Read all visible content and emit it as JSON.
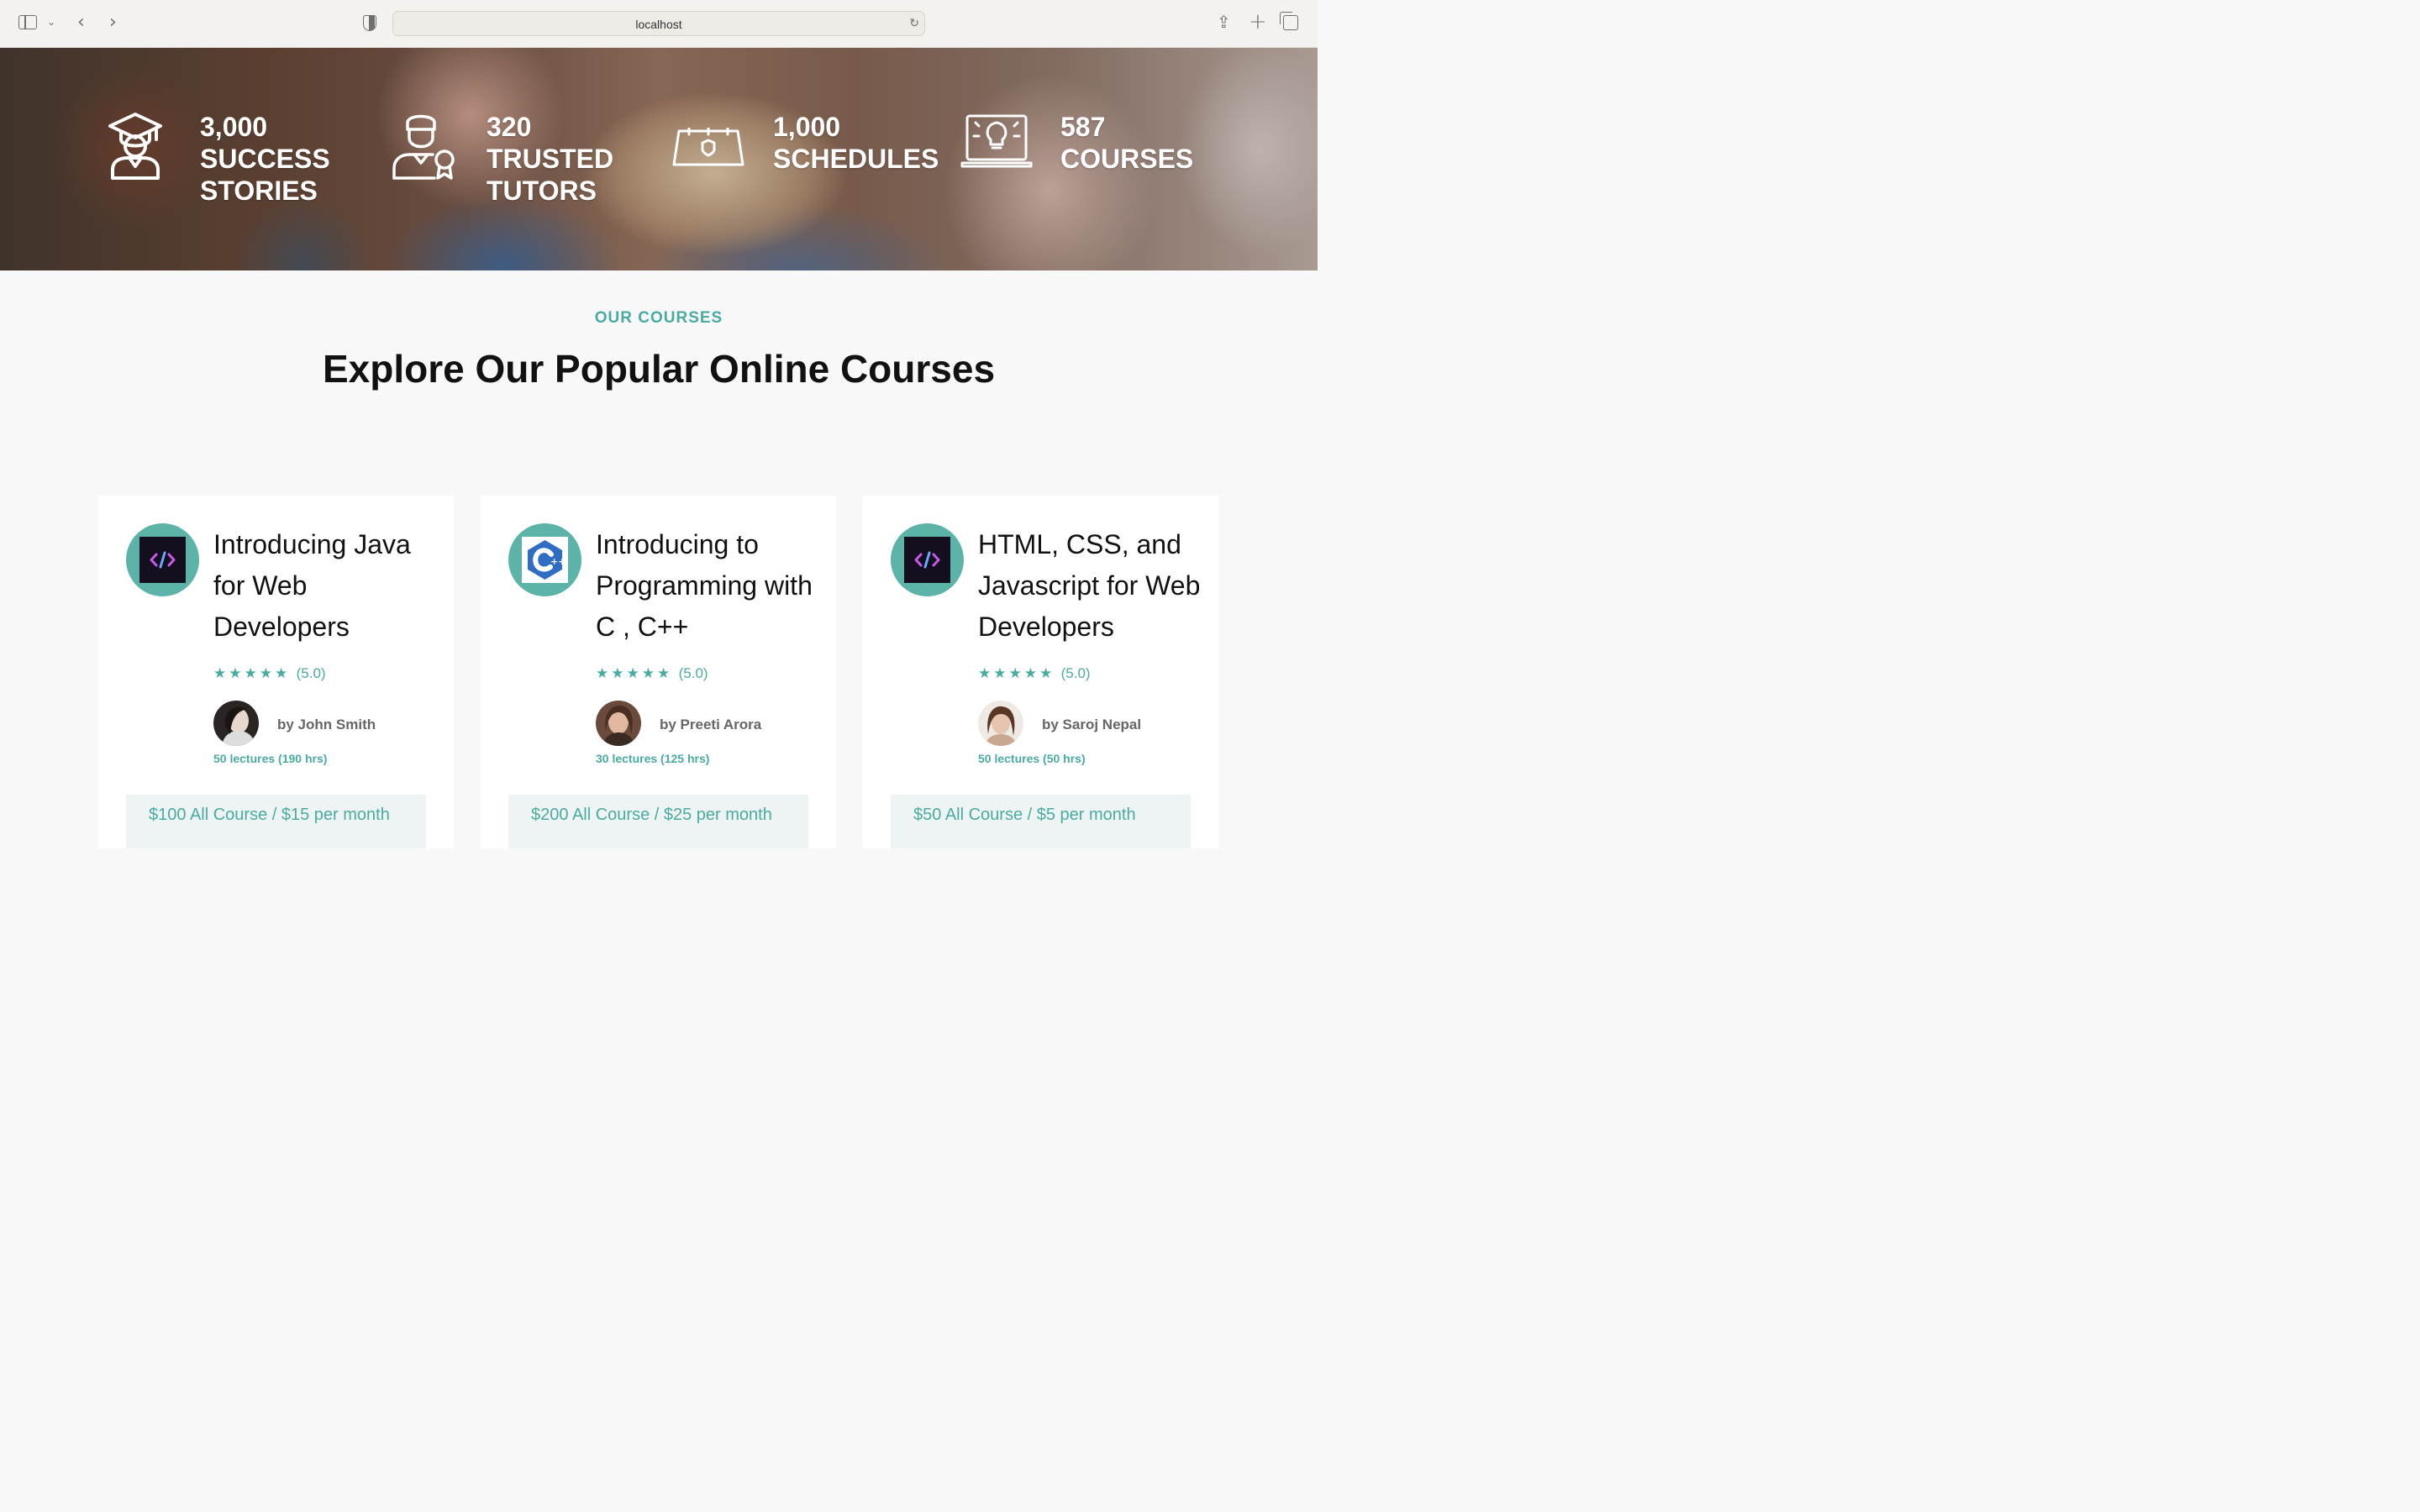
{
  "browser": {
    "url": "localhost"
  },
  "stats": [
    {
      "icon": "graduate-icon",
      "number": "3,000",
      "line1": "SUCCESS",
      "line2": "STORIES"
    },
    {
      "icon": "tutor-icon",
      "number": "320",
      "line1": "TRUSTED",
      "line2": "TUTORS"
    },
    {
      "icon": "calendar-icon",
      "number": "1,000",
      "line1": "SCHEDULES",
      "line2": ""
    },
    {
      "icon": "laptop-bulb-icon",
      "number": "587",
      "line1": "COURSES",
      "line2": ""
    }
  ],
  "section": {
    "eyebrow": "OUR COURSES",
    "title": "Explore Our Popular Online Courses"
  },
  "courses": [
    {
      "logo": "code-icon",
      "title": "Introducing Java for Web Developers",
      "stars": "★★★★★",
      "score": "(5.0)",
      "author": "by John Smith",
      "lectures": "50 lectures (190 hrs)",
      "price": "$100 All Course / $15 per month"
    },
    {
      "logo": "cpp-icon",
      "title": "Introducing to Programming with C , C++",
      "stars": "★★★★★",
      "score": "(5.0)",
      "author": "by Preeti Arora",
      "lectures": "30 lectures (125 hrs)",
      "price": "$200 All Course / $25 per month"
    },
    {
      "logo": "code-icon",
      "title": "HTML, CSS, and Javascript for Web Developers",
      "stars": "★★★★★",
      "score": "(5.0)",
      "author": "by Saroj Nepal",
      "lectures": "50 lectures (50 hrs)",
      "price": "$50 All Course / $5 per month"
    }
  ],
  "colors": {
    "accent": "#4aaba0",
    "badge": "#5cb3a8",
    "price_bg": "#eef4f3"
  }
}
